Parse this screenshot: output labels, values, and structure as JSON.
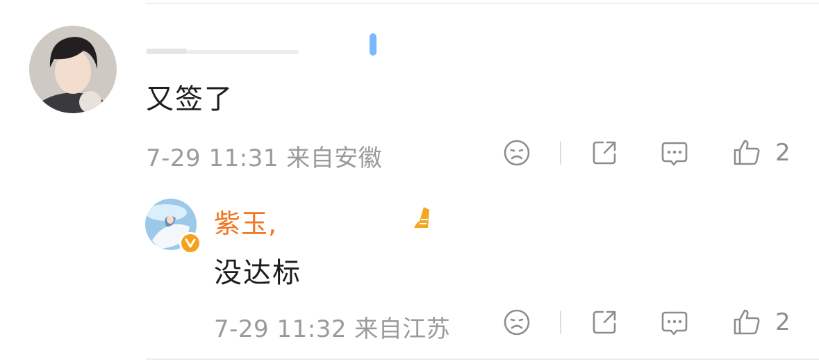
{
  "comment": {
    "text": "又签了",
    "meta": "7-29 11:31 来自安徽",
    "like_count": "2"
  },
  "reply": {
    "username": "紫玉,",
    "text": "没达标",
    "meta": "7-29 11:32 来自江苏",
    "like_count": "2"
  },
  "colors": {
    "username": "#f0761f",
    "meta": "#9a9a9a",
    "badge": "#f4a21b"
  }
}
